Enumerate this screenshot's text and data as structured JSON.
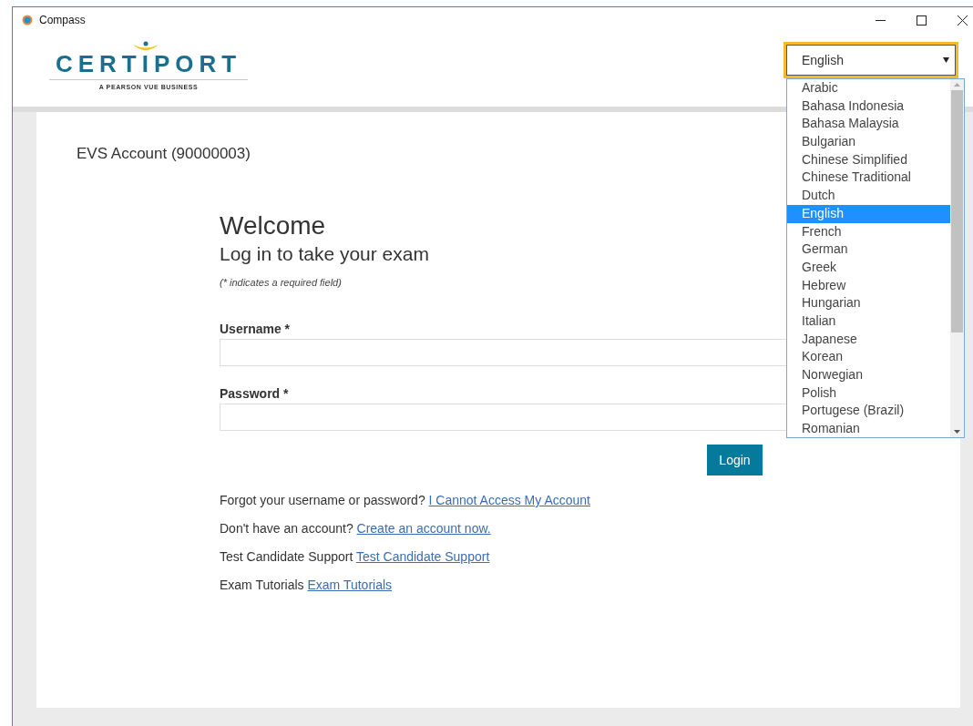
{
  "window": {
    "title": "Compass"
  },
  "logo": {
    "wordmark": "CERTIPORT",
    "tagline": "A PEARSON VUE BUSINESS"
  },
  "language_select": {
    "value": "English",
    "expanded": true,
    "options": [
      {
        "label": "Arabic",
        "selected": false
      },
      {
        "label": "Bahasa Indonesia",
        "selected": false
      },
      {
        "label": "Bahasa Malaysia",
        "selected": false
      },
      {
        "label": "Bulgarian",
        "selected": false
      },
      {
        "label": "Chinese Simplified",
        "selected": false
      },
      {
        "label": "Chinese Traditional",
        "selected": false
      },
      {
        "label": "Dutch",
        "selected": false
      },
      {
        "label": "English",
        "selected": true
      },
      {
        "label": "French",
        "selected": false
      },
      {
        "label": "German",
        "selected": false
      },
      {
        "label": "Greek",
        "selected": false
      },
      {
        "label": "Hebrew",
        "selected": false
      },
      {
        "label": "Hungarian",
        "selected": false
      },
      {
        "label": "Italian",
        "selected": false
      },
      {
        "label": "Japanese",
        "selected": false
      },
      {
        "label": "Korean",
        "selected": false
      },
      {
        "label": "Norwegian",
        "selected": false
      },
      {
        "label": "Polish",
        "selected": false
      },
      {
        "label": "Portugese (Brazil)",
        "selected": false
      },
      {
        "label": "Romanian",
        "selected": false
      }
    ]
  },
  "account_label": "EVS Account (90000003)",
  "form": {
    "heading": "Welcome",
    "subheading": "Log in to take your exam",
    "required_note": "(* indicates a required field)",
    "fields": [
      {
        "label": "Username *"
      },
      {
        "label": "Password *"
      }
    ],
    "submit": "Login"
  },
  "help_lines": [
    {
      "text": "Forgot your username or password?",
      "link": "I Cannot Access My Account"
    },
    {
      "text": "Don't have an account?",
      "link": "Create an account now."
    },
    {
      "text": "Test Candidate Support",
      "link": "Test Candidate Support"
    },
    {
      "text": "Exam Tutorials",
      "link": "Exam Tutorials"
    }
  ]
}
